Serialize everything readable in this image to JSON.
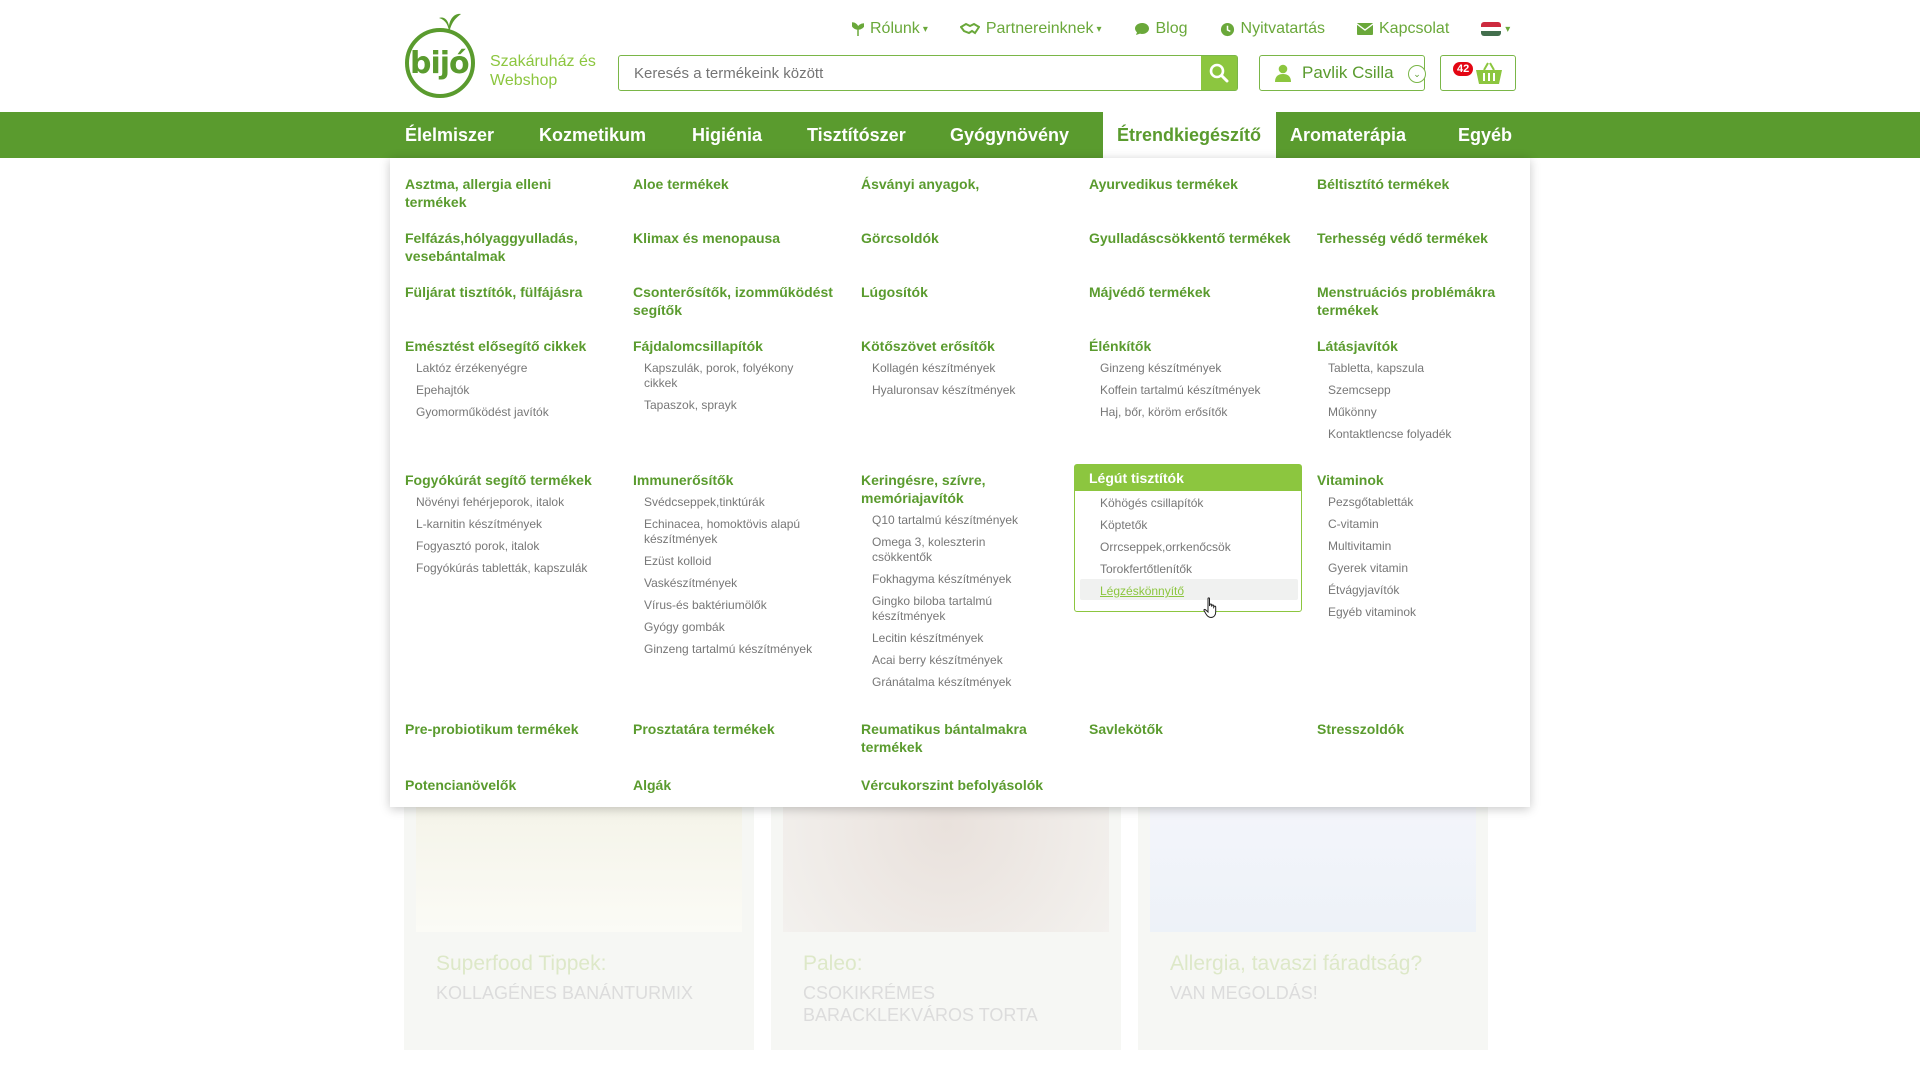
{
  "brand": {
    "logo_word": "bijó",
    "tagline": "Szakáruház és Webshop"
  },
  "topnav": [
    {
      "label": "Rólunk",
      "caret": true
    },
    {
      "label": "Partnereinknek",
      "caret": true
    },
    {
      "label": "Blog",
      "caret": false
    },
    {
      "label": "Nyitvatartás",
      "caret": false
    },
    {
      "label": "Kapcsolat",
      "caret": false
    }
  ],
  "search": {
    "placeholder": "Keresés a termékeink között"
  },
  "user": {
    "name": "Pavlik Csilla"
  },
  "cart": {
    "count": "42"
  },
  "mainnav": [
    "Élelmiszer",
    "Kozmetikum",
    "Higiénia",
    "Tisztítószer",
    "Gyógynövény",
    "Étrendkiegészítő",
    "Aromaterápia",
    "Egyéb"
  ],
  "mainnav_active": "Étrendkiegészítő",
  "mega": {
    "row1": [
      "Asztma, allergia elleni termékek",
      "Aloe termékek",
      "Ásványi anyagok,",
      "Ayurvedikus termékek",
      "Béltisztító termékek"
    ],
    "row2": [
      "Felfázás,hólyaggyulladás, vesebántalmak",
      "Klimax és menopausa",
      "Görcsoldók",
      "Gyulladáscsökkentő termékek",
      "Terhesség védő termékek"
    ],
    "row3": [
      "Füljárat tisztítók, fülfájásra",
      "Csonterősítők, izomműködést segítők",
      "Lúgosítók",
      "Májvédő termékek",
      "Menstruációs problémákra termékek"
    ],
    "row4": [
      {
        "title": "Emésztést elősegítő cikkek",
        "subs": [
          "Laktóz érzékenyégre",
          "Epehajtók",
          "Gyomorműködést javítók"
        ]
      },
      {
        "title": "Fájdalomcsillapítók",
        "subs": [
          "Kapszulák, porok, folyékony cikkek",
          "Tapaszok, sprayk"
        ]
      },
      {
        "title": "Kötőszövet erősítők",
        "subs": [
          "Kollagén készítmények",
          "Hyaluronsav készítmények"
        ]
      },
      {
        "title": "Élénkítők",
        "subs": [
          "Ginzeng készítmények",
          "Koffein tartalmú készítmények",
          "Haj, bőr, köröm erősítők"
        ]
      },
      {
        "title": "Látásjavítók",
        "subs": [
          "Tabletta, kapszula",
          "Szemcsepp",
          "Műkönny",
          "Kontaktlencse folyadék"
        ]
      }
    ],
    "row5": [
      {
        "title": "Fogyókúrát segítő termékek",
        "subs": [
          "Növényi fehérjeporok, italok",
          "L-karnitin készítmények",
          "Fogyasztó porok, italok",
          "Fogyókúrás tabletták, kapszulák"
        ]
      },
      {
        "title": "Immunerősítők",
        "subs": [
          "Svédcseppek,tinktúrák",
          "Echinacea, homoktövis alapú készítmények",
          "Ezüst kolloid",
          "Vaskészítmények",
          "Vírus-és baktériumölők",
          "Gyógy gombák",
          "Ginzeng tartalmú készítmények"
        ]
      },
      {
        "title": "Keringésre, szívre, memóriajavítók",
        "subs": [
          "Q10 tartalmú készítmények",
          "Omega 3, koleszterin csökkentők",
          "Fokhagyma készítmények",
          "Gingko biloba tartalmú készítmények",
          "Lecitin készítmények",
          "Acai berry készítmények",
          "Gránátalma készítmények"
        ]
      },
      {
        "title": "Légút tisztítók",
        "subs": [
          "Köhögés csillapítók",
          "Köptetők",
          "Orrcseppek,orrkenőcsök",
          "Torokfertőtlenítők",
          "Légzéskönnyítő"
        ]
      },
      {
        "title": "Vitaminok",
        "subs": [
          "Pezsgőtabletták",
          "C-vitamin",
          "Multivitamin",
          "Gyerek vitamin",
          "Étvágyjavítók",
          "Egyéb vitaminok"
        ]
      }
    ],
    "row6": [
      "Pre-probiotikum termékek",
      "Prosztatára termékek",
      "Reumatikus bántalmakra termékek",
      "Savlekötők",
      "Stresszoldók"
    ],
    "row7": [
      "Potencianövelők",
      "Algák",
      "Vércukorszint befolyásolók"
    ]
  },
  "blog": [
    {
      "title": "Superfood Tippek:",
      "sub": "KOLLAGÉNES BANÁNTURMIX"
    },
    {
      "title": "Paleo:",
      "sub": "CSOKIKRÉMES BARACKLEKVÁROS TORTA"
    },
    {
      "title": "Allergia, tavaszi fáradtság?",
      "sub": "VAN MEGOLDÁS!"
    }
  ],
  "colors": {
    "brand_green": "#5a9b2e",
    "light_green": "#8cc63f",
    "badge_red": "#e30613"
  }
}
